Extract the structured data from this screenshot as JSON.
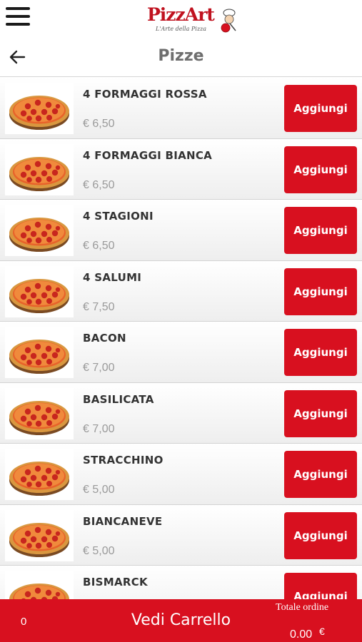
{
  "app": {
    "logo_text": "PizzArt",
    "logo_tagline": "L'Arte della Pizza"
  },
  "header": {
    "title": "Pizze"
  },
  "colors": {
    "accent": "#d8101f",
    "title_gray": "#6e6e6e",
    "price_gray": "#9a9a9a"
  },
  "icons": {
    "menu": "hamburger-menu-icon",
    "back": "back-arrow-icon",
    "product": "pizza-image"
  },
  "products": [
    {
      "name": "4 FORMAGGI ROSSA",
      "price": "€ 6,50",
      "button": "Aggiungi"
    },
    {
      "name": "4 FORMAGGI BIANCA",
      "price": "€ 6,50",
      "button": "Aggiungi"
    },
    {
      "name": "4 STAGIONI",
      "price": "€ 6,50",
      "button": "Aggiungi"
    },
    {
      "name": "4 SALUMI",
      "price": "€ 7,50",
      "button": "Aggiungi"
    },
    {
      "name": "BACON",
      "price": "€ 7,00",
      "button": "Aggiungi"
    },
    {
      "name": "BASILICATA",
      "price": "€ 7,00",
      "button": "Aggiungi"
    },
    {
      "name": "STRACCHINO",
      "price": "€ 5,00",
      "button": "Aggiungi"
    },
    {
      "name": "BIANCANEVE",
      "price": "€ 5,00",
      "button": "Aggiungi"
    },
    {
      "name": "BISMARCK",
      "price": "",
      "button": "Aggiungi"
    }
  ],
  "cart": {
    "count": "0",
    "label": "Vedi Carrello",
    "total_label": "Totale ordine",
    "total_value": "0.00",
    "currency": "€"
  }
}
